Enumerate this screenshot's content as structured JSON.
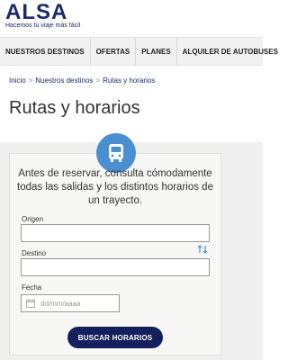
{
  "header": {
    "logo": "ALSA",
    "tagline": "Hacemos tu viaje más fácil"
  },
  "nav": {
    "items": [
      {
        "label": "NUESTROS DESTINOS"
      },
      {
        "label": "OFERTAS"
      },
      {
        "label": "PLANES"
      },
      {
        "label": "ALQUILER DE AUTOBUSES"
      }
    ]
  },
  "breadcrumb": [
    "Inicio",
    "Nuestros destinos",
    "Rutas y horarios"
  ],
  "page": {
    "title": "Rutas y horarios"
  },
  "form": {
    "intro": "Antes de reservar, consulta cómodamente todas las salidas y los distintos horarios de un trayecto.",
    "origin_label": "Origen",
    "origin_value": "",
    "destination_label": "Destino",
    "destination_value": "",
    "date_label": "Fecha",
    "date_placeholder": "dd/mm/aaaa",
    "submit_label": "BUSCAR HORARIOS"
  },
  "colors": {
    "brand": "#1b2a6b",
    "button": "#14205e",
    "accent": "#4a8fd1"
  }
}
